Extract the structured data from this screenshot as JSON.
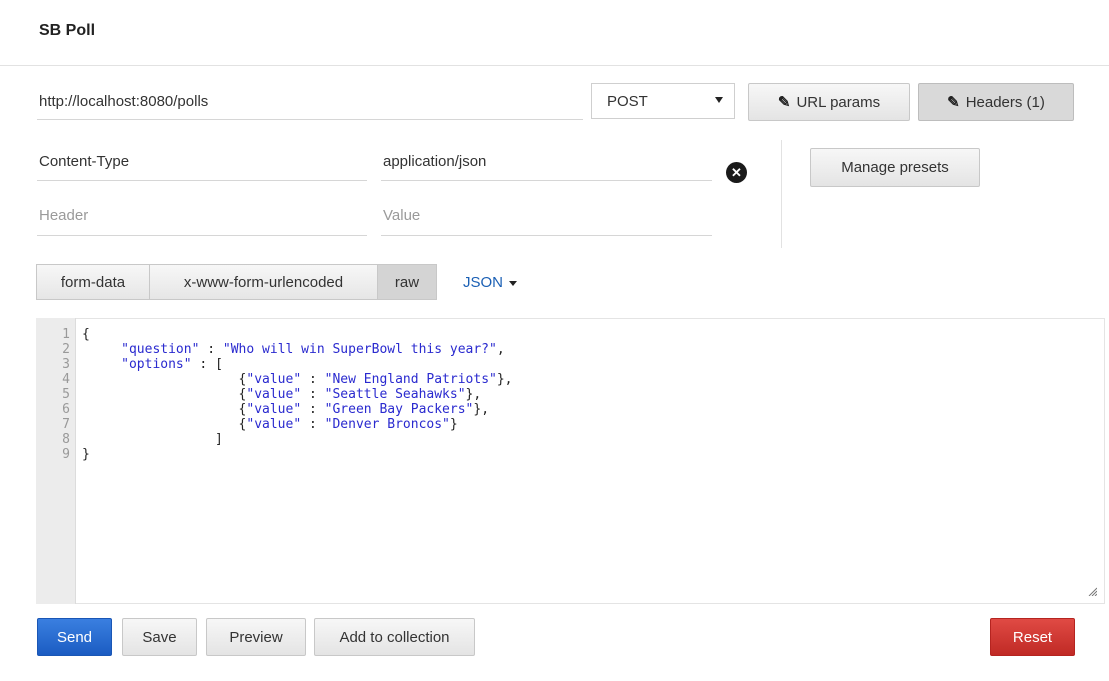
{
  "app": {
    "title": "SB Poll"
  },
  "request": {
    "url": "http://localhost:8080/polls",
    "method": "POST",
    "url_params_label": "URL params",
    "headers_label": "Headers (1)"
  },
  "headers": {
    "rows": [
      {
        "key": "Content-Type",
        "value": "application/json"
      }
    ],
    "new_key_placeholder": "Header",
    "new_value_placeholder": "Value",
    "manage_presets_label": "Manage presets"
  },
  "body": {
    "tabs": [
      "form-data",
      "x-www-form-urlencoded",
      "raw"
    ],
    "active_tab": "raw",
    "format": "JSON",
    "line_numbers": [
      "1",
      "2",
      "3",
      "4",
      "5",
      "6",
      "7",
      "8",
      "9"
    ],
    "code_lines": [
      "{",
      "     \"question\" : \"Who will win SuperBowl this year?\",",
      "     \"options\" : [",
      "                    {\"value\" : \"New England Patriots\"},",
      "                    {\"value\" : \"Seattle Seahawks\"},",
      "                    {\"value\" : \"Green Bay Packers\"},",
      "                    {\"value\" : \"Denver Broncos\"}",
      "                 ]",
      "}"
    ]
  },
  "actions": {
    "send": "Send",
    "save": "Save",
    "preview": "Preview",
    "add_to_collection": "Add to collection",
    "reset": "Reset"
  },
  "colors": {
    "send_button": "#1b5cc2",
    "reset_button": "#c02a25",
    "json_link": "#1a5fb4"
  }
}
